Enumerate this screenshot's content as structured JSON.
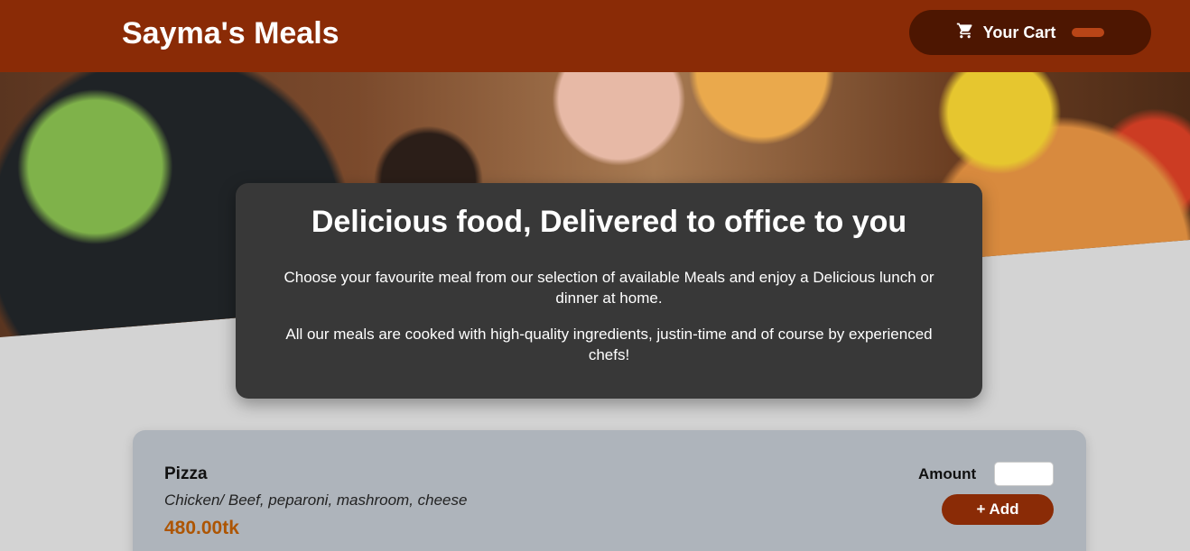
{
  "header": {
    "brand": "Sayma's Meals",
    "cart_label": "Your Cart",
    "cart_count": ""
  },
  "summary": {
    "title": "Delicious food, Delivered to office to you",
    "para1": "Choose your favourite meal from our selection of available Meals and enjoy a Delicious lunch or dinner at home.",
    "para2": "All our meals are cooked with high-quality ingredients, justin-time and of course by experienced chefs!"
  },
  "meals": [
    {
      "name": "Pizza",
      "description": "Chicken/ Beef, peparoni, mashroom, cheese",
      "price": "480.00tk",
      "amount_label": "Amount",
      "amount_value": "",
      "add_label": "+ Add"
    }
  ],
  "colors": {
    "header_bg": "#8a2b06",
    "cart_bg": "#4d1601",
    "summary_bg": "#383838",
    "meal_card_bg": "#aeb4bb",
    "price_color": "#ad5502"
  },
  "icons": {
    "cart": "cart-icon"
  }
}
